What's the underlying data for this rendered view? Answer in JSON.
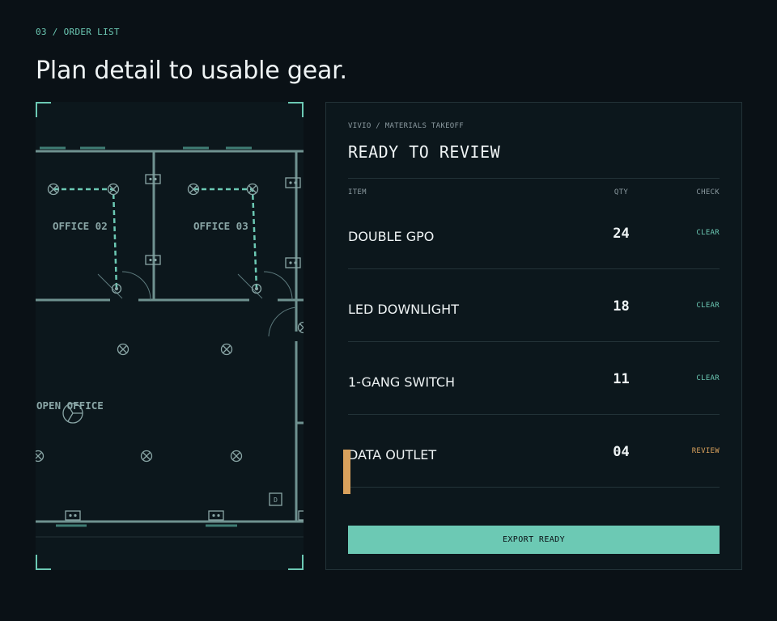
{
  "header": {
    "eyebrow": "03 / ORDER LIST",
    "title": "Plan detail to usable gear."
  },
  "plan": {
    "room_labels": [
      "OFFICE 02",
      "OFFICE 03",
      "OPEN OFFICE"
    ],
    "data_symbol": "D",
    "colors": {
      "wall": "#6f9290",
      "accent": "#6cc9b4",
      "symbol": "#8aa6a6"
    }
  },
  "panel": {
    "source": "VIVIO / MATERIALS TAKEOFF",
    "title": "READY TO REVIEW",
    "columns": {
      "item": "ITEM",
      "qty": "QTY",
      "check": "CHECK"
    },
    "rows": [
      {
        "item": "DOUBLE GPO",
        "qty": "24",
        "check": "CLEAR",
        "flagged": false
      },
      {
        "item": "LED DOWNLIGHT",
        "qty": "18",
        "check": "CLEAR",
        "flagged": false
      },
      {
        "item": "1-GANG SWITCH",
        "qty": "11",
        "check": "CLEAR",
        "flagged": false
      },
      {
        "item": "DATA OUTLET",
        "qty": "04",
        "check": "REVIEW",
        "flagged": true
      }
    ],
    "export_label": "EXPORT READY"
  },
  "colors": {
    "accent": "#6cc9b4",
    "review": "#d9a15c",
    "background": "#0a1116",
    "panel": "#0c171c"
  }
}
